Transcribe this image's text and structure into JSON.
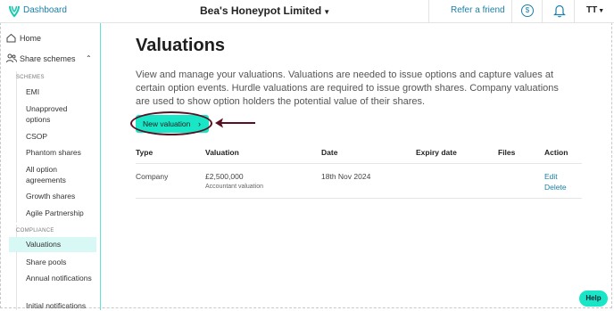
{
  "header": {
    "dashboard_label": "Dashboard",
    "company_name": "Bea's Honeypot Limited",
    "refer_label": "Refer a friend",
    "user_initials": "TT"
  },
  "sidebar": {
    "home": "Home",
    "share_schemes": "Share schemes",
    "schemes_heading": "SCHEMES",
    "schemes": [
      "EMI",
      "Unapproved options",
      "CSOP",
      "Phantom shares",
      "All option agreements",
      "Growth shares",
      "Agile Partnership"
    ],
    "compliance_heading": "COMPLIANCE",
    "compliance": [
      "Valuations",
      "Share pools",
      "Annual notifications",
      "Initial notifications"
    ],
    "active_item": "Valuations"
  },
  "main": {
    "title": "Valuations",
    "description": "View and manage your valuations. Valuations are needed to issue options and capture values at certain option events. Hurdle valuations are required to issue growth shares. Company valuations are used to show option holders the potential value of their shares.",
    "new_valuation_label": "New valuation",
    "table": {
      "headers": [
        "Type",
        "Valuation",
        "Date",
        "Expiry date",
        "Files",
        "Action"
      ],
      "rows": [
        {
          "type": "Company",
          "valuation": "£2,500,000",
          "valuation_note": "Accountant valuation",
          "date": "18th Nov 2024",
          "expiry_date": "",
          "files": "",
          "actions": [
            "Edit",
            "Delete"
          ]
        }
      ]
    }
  },
  "help_label": "Help",
  "colors": {
    "accent": "#18e6c6",
    "link": "#1b7fa6",
    "active_bg": "#d7f8f4",
    "annotation": "#5a0f24"
  }
}
